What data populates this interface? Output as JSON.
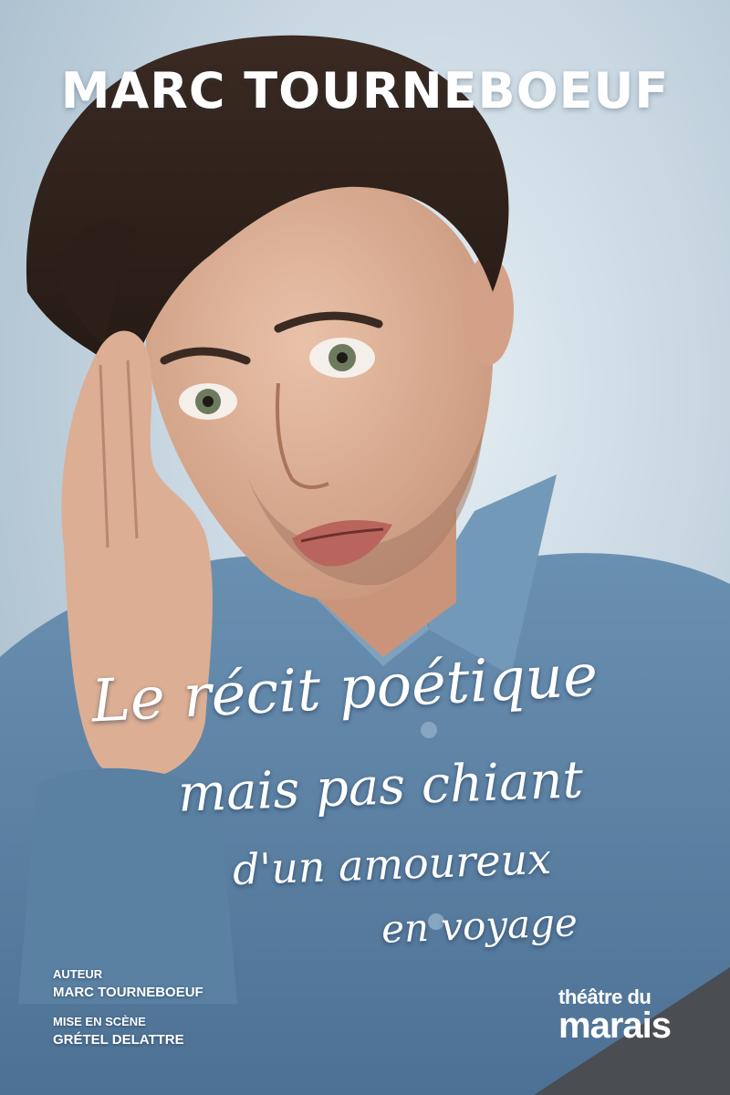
{
  "poster": {
    "title": "MARC TOURNEBOEUF",
    "tagline": {
      "line1": "Le récit poétique",
      "line2": "mais pas chiant",
      "line3": "d'un amoureux",
      "line4": "en voyage"
    },
    "credits": {
      "author_label": "AUTEUR",
      "author_name": "MARC TOURNEBOEUF",
      "director_label": "MISE EN SCÈNE",
      "director_name": "GRÉTEL DELATTRE"
    },
    "venue": {
      "line1": "théâtre du",
      "line2": "marais"
    },
    "colors": {
      "background": "#c7d6e1",
      "shirt": "#5f86a8",
      "venue_corner": "#4a4d52",
      "accent_red": "#d6242b"
    }
  }
}
